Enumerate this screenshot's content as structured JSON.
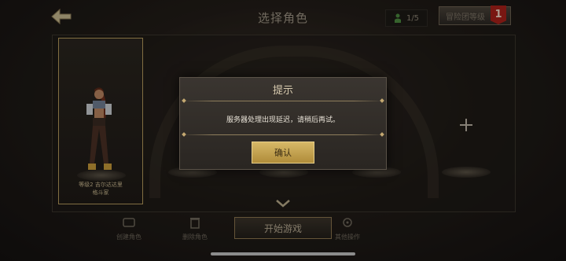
{
  "header": {
    "title": "选择角色",
    "slot_count": "1/5",
    "ranking_label": "冒险团等级",
    "ranking_badge": "1"
  },
  "character": {
    "level_line": "等级2 吉尔达达里",
    "class_line": "格斗家"
  },
  "bottom_bar": {
    "create_label": "创建角色",
    "delete_label": "删除角色",
    "start_label": "开始游戏",
    "other_label": "其他操作"
  },
  "dialog": {
    "title": "提示",
    "message": "服务器处理出现延迟，请稍后再试。",
    "confirm_label": "确认"
  },
  "colors": {
    "accent_gold": "#c4a871",
    "confirm_button": "#c9a652",
    "badge_red": "#a8201a"
  },
  "icons": {
    "back": "arrow-left-icon",
    "slots": "character-icon",
    "add": "plus-icon",
    "down": "chevron-down-icon"
  }
}
